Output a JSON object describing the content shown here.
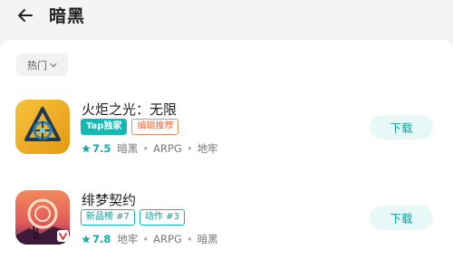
{
  "header": {
    "back_icon": "arrow-left-icon",
    "title": "暗黑"
  },
  "filter": {
    "label": "热门",
    "icon": "chevron-down-icon"
  },
  "apps": [
    {
      "name": "火炬之光：无限",
      "tags": [
        "Tap独家",
        "编辑推荐"
      ],
      "rating": "7.5",
      "meta": [
        "暗黑",
        "ARPG",
        "地牢"
      ],
      "button": "下载"
    },
    {
      "name": "绯梦契约",
      "tags": [
        "新品榜 #7",
        "动作 #3"
      ],
      "rating": "7.8",
      "meta": [
        "地牢",
        "ARPG",
        "暗黑"
      ],
      "button": "下载"
    }
  ],
  "colors": {
    "accent": "#16b9b2",
    "orange_tag": "#ee6b43",
    "background": "#f3f4f6"
  }
}
